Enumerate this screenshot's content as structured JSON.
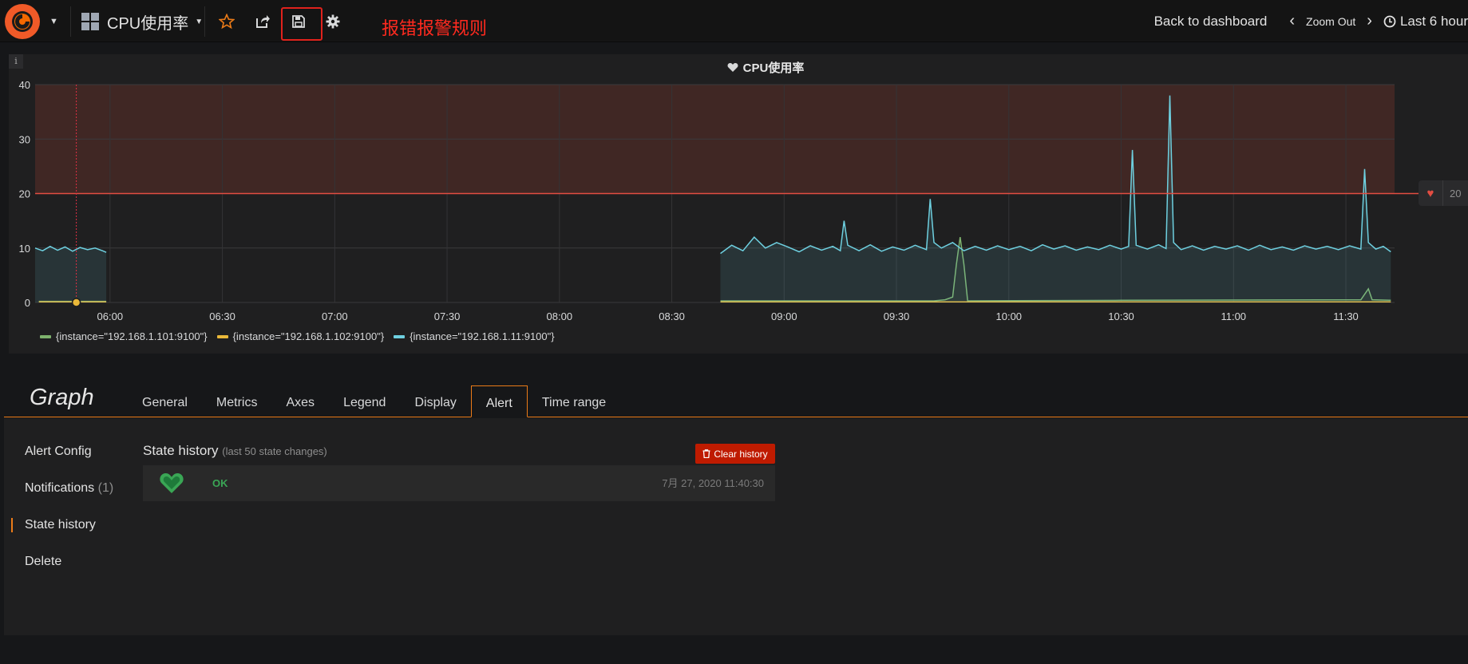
{
  "navbar": {
    "dashboard_title": "CPU使用率",
    "annotation": "报错报警规则",
    "back_to_dashboard": "Back to dashboard",
    "zoom_out": "Zoom Out",
    "time_range": "Last 6 hour"
  },
  "panel": {
    "title": "CPU使用率",
    "info_icon": "i",
    "threshold_value": "20"
  },
  "chart_data": {
    "type": "line",
    "title": "CPU使用率",
    "ylim": [
      0,
      40
    ],
    "y_ticks": [
      "0",
      "10",
      "20",
      "30",
      "40"
    ],
    "x_ticks": [
      "06:00",
      "06:30",
      "07:00",
      "07:30",
      "08:00",
      "08:30",
      "09:00",
      "09:30",
      "10:00",
      "10:30",
      "11:00",
      "11:30"
    ],
    "xlim": [
      "05:40",
      "11:43"
    ],
    "threshold": 20,
    "legend_position": "bottom-left",
    "series": [
      {
        "name": "{instance=\"192.168.1.101:9100\"}",
        "color": "#7eb26d",
        "points": [
          [
            "05:41",
            0.2
          ],
          [
            "05:59",
            0.2
          ],
          null,
          [
            "08:43",
            0.3
          ],
          [
            "09:40",
            0.3
          ],
          [
            "09:43",
            0.5
          ],
          [
            "09:45",
            1.0
          ],
          [
            "09:46",
            7
          ],
          [
            "09:47",
            12
          ],
          [
            "09:48",
            7
          ],
          [
            "09:49",
            0.3
          ],
          [
            "10:30",
            0.4
          ],
          [
            "11:34",
            0.5
          ],
          [
            "11:36",
            2.5
          ],
          [
            "11:37",
            0.5
          ],
          [
            "11:42",
            0.4
          ]
        ]
      },
      {
        "name": "{instance=\"192.168.1.102:9100\"}",
        "color": "#eab839",
        "points": [
          [
            "05:41",
            0.1
          ],
          [
            "05:59",
            0.1
          ],
          null,
          [
            "08:43",
            0.1
          ],
          [
            "11:42",
            0.1
          ]
        ]
      },
      {
        "name": "{instance=\"192.168.1.11:9100\"}",
        "color": "#6ed0e0",
        "points": [
          [
            "05:40",
            10
          ],
          [
            "05:42",
            9.5
          ],
          [
            "05:44",
            10.3
          ],
          [
            "05:46",
            9.6
          ],
          [
            "05:48",
            10.2
          ],
          [
            "05:50",
            9.4
          ],
          [
            "05:52",
            10.1
          ],
          [
            "05:54",
            9.7
          ],
          [
            "05:56",
            10.0
          ],
          [
            "05:58",
            9.5
          ],
          [
            "05:59",
            9.2
          ],
          null,
          [
            "08:43",
            9.0
          ],
          [
            "08:46",
            10.5
          ],
          [
            "08:49",
            9.5
          ],
          [
            "08:52",
            12.0
          ],
          [
            "08:55",
            10.0
          ],
          [
            "08:58",
            11.0
          ],
          [
            "09:01",
            10.2
          ],
          [
            "09:04",
            9.3
          ],
          [
            "09:07",
            10.4
          ],
          [
            "09:10",
            9.6
          ],
          [
            "09:13",
            10.3
          ],
          [
            "09:15",
            9.5
          ],
          [
            "09:16",
            15.0
          ],
          [
            "09:17",
            10.5
          ],
          [
            "09:20",
            9.5
          ],
          [
            "09:23",
            10.6
          ],
          [
            "09:26",
            9.4
          ],
          [
            "09:29",
            10.2
          ],
          [
            "09:32",
            9.6
          ],
          [
            "09:35",
            10.5
          ],
          [
            "09:38",
            9.7
          ],
          [
            "09:39",
            19.0
          ],
          [
            "09:40",
            11.0
          ],
          [
            "09:42",
            10.0
          ],
          [
            "09:45",
            11.0
          ],
          [
            "09:48",
            9.5
          ],
          [
            "09:51",
            10.3
          ],
          [
            "09:54",
            9.6
          ],
          [
            "09:57",
            10.4
          ],
          [
            "10:00",
            9.7
          ],
          [
            "10:03",
            10.3
          ],
          [
            "10:06",
            9.5
          ],
          [
            "10:09",
            10.6
          ],
          [
            "10:12",
            9.8
          ],
          [
            "10:15",
            10.4
          ],
          [
            "10:18",
            9.6
          ],
          [
            "10:21",
            10.2
          ],
          [
            "10:24",
            9.7
          ],
          [
            "10:27",
            10.5
          ],
          [
            "10:30",
            9.8
          ],
          [
            "10:32",
            10.3
          ],
          [
            "10:33",
            28.0
          ],
          [
            "10:34",
            10.5
          ],
          [
            "10:37",
            9.8
          ],
          [
            "10:40",
            10.6
          ],
          [
            "10:42",
            9.9
          ],
          [
            "10:43",
            38.0
          ],
          [
            "10:44",
            11.0
          ],
          [
            "10:46",
            9.7
          ],
          [
            "10:49",
            10.4
          ],
          [
            "10:52",
            9.6
          ],
          [
            "10:55",
            10.3
          ],
          [
            "10:58",
            9.8
          ],
          [
            "11:01",
            10.4
          ],
          [
            "11:04",
            9.6
          ],
          [
            "11:07",
            10.5
          ],
          [
            "11:10",
            9.7
          ],
          [
            "11:13",
            10.2
          ],
          [
            "11:16",
            9.6
          ],
          [
            "11:19",
            10.4
          ],
          [
            "11:22",
            9.8
          ],
          [
            "11:25",
            10.3
          ],
          [
            "11:28",
            9.7
          ],
          [
            "11:31",
            10.4
          ],
          [
            "11:34",
            9.8
          ],
          [
            "11:35",
            24.5
          ],
          [
            "11:36",
            11.0
          ],
          [
            "11:38",
            9.8
          ],
          [
            "11:40",
            10.3
          ],
          [
            "11:42",
            9.3
          ]
        ]
      }
    ]
  },
  "legend": [
    {
      "label": "{instance=\"192.168.1.101:9100\"}",
      "color": "#7eb26d"
    },
    {
      "label": "{instance=\"192.168.1.102:9100\"}",
      "color": "#eab839"
    },
    {
      "label": "{instance=\"192.168.1.11:9100\"}",
      "color": "#6ed0e0"
    }
  ],
  "editor": {
    "title": "Graph",
    "tabs": [
      "General",
      "Metrics",
      "Axes",
      "Legend",
      "Display",
      "Alert",
      "Time range"
    ],
    "active_tab": "Alert",
    "side_menu": {
      "alert_config": "Alert Config",
      "notifications": "Notifications",
      "notifications_count": "(1)",
      "state_history": "State history",
      "delete": "Delete"
    },
    "state_history": {
      "title": "State history",
      "subtitle": "(last 50 state changes)",
      "clear_button": "Clear history",
      "rows": [
        {
          "state": "OK",
          "time": "7月 27, 2020 11:40:30"
        }
      ]
    }
  },
  "colors": {
    "accent": "#eb7b18",
    "alert_red": "#e24d42",
    "ok_green": "#3aa655",
    "annotation_red": "#ff2a1f"
  }
}
